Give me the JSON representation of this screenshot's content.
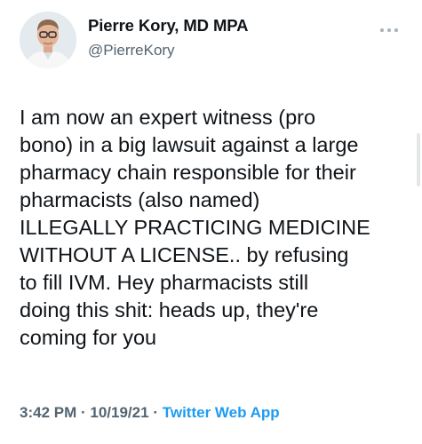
{
  "tweet": {
    "display_name": "Pierre Kory, MD MPA",
    "handle": "@PierreKory",
    "more_icon": "more-horizontal-icon",
    "text_lines": [
      "I am now an expert witness (pro",
      "bono) in a big lawsuit against a large",
      "pharmacy chain responsible for their",
      "pharmacists (also named)",
      "ILLEGALLY PRACTICING MEDICINE",
      "WITHOUT A LICENSE.. by refusing",
      "to fill IVM. Hey pharmacists still",
      "doing this shit: heads up, they're",
      "coming for you"
    ],
    "time": "3:42 PM",
    "date": "10/19/21",
    "separator": "·",
    "source": "Twitter Web App"
  },
  "colors": {
    "text": "#0f1419",
    "secondary": "#536471",
    "link": "#1d9bf0"
  }
}
